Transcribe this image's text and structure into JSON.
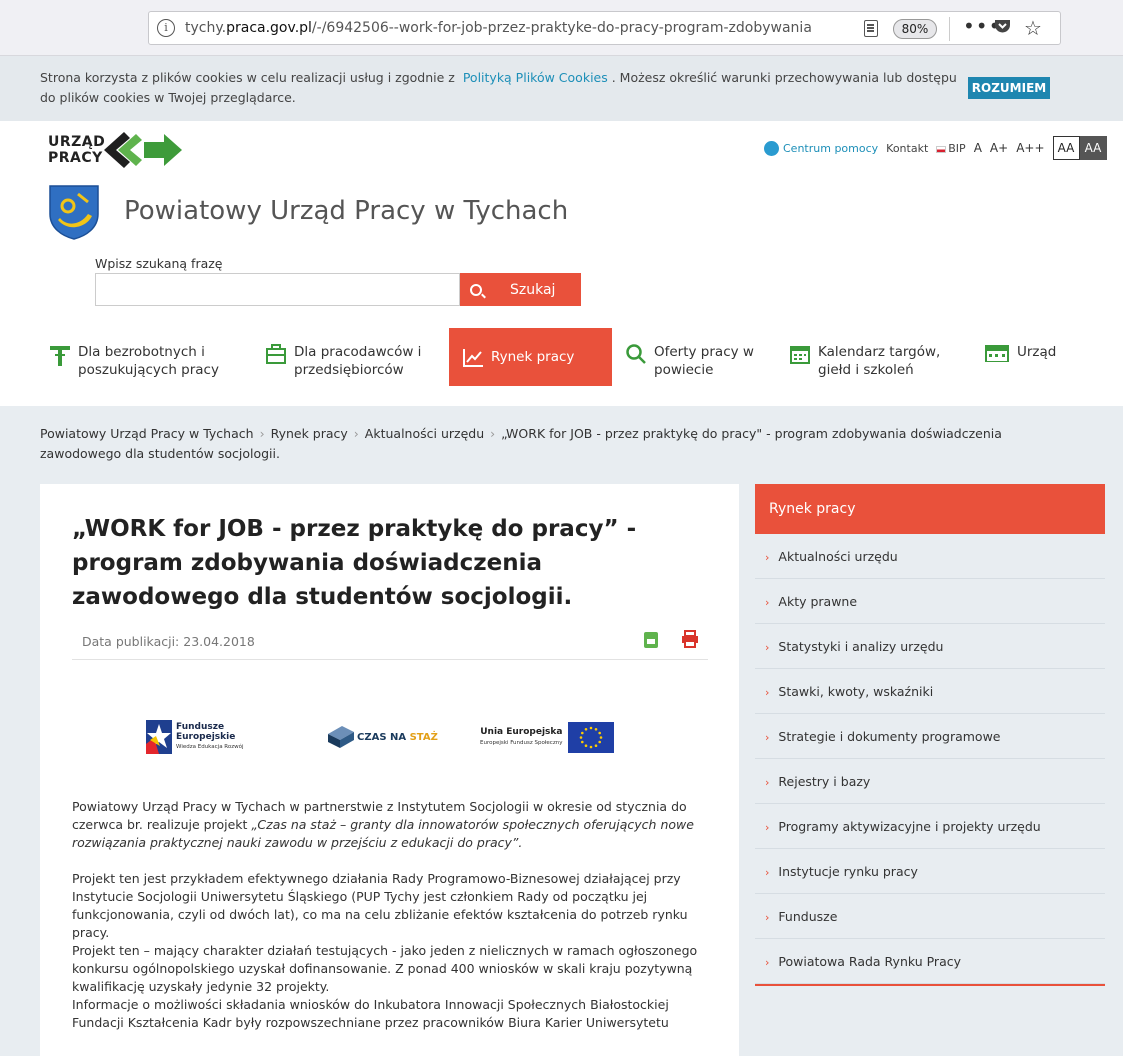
{
  "browser": {
    "url_prefix": "tychy.",
    "url_domain": "praca.gov.pl",
    "url_rest": "/-/6942506--work-for-job-przez-praktyke-do-pracy-program-zdobywania",
    "zoom": "80%",
    "menu_dots": "•••"
  },
  "cookie": {
    "text_before": "Strona korzysta z plików cookies w celu realizacji usług i zgodnie z",
    "link": "Polityką Plików Cookies",
    "text_after": ". Możesz określić warunki przechowywania lub dostępu do plików cookies w Twojej przeglądarce.",
    "button": "ROZUMIEM"
  },
  "header": {
    "logo_line1": "URZĄD",
    "logo_line2": "PRACY",
    "help": "Centrum pomocy",
    "contact": "Kontakt",
    "bip": "BIP",
    "font_sizes": [
      "A",
      "A+",
      "A++"
    ],
    "contrast": [
      "AA",
      "AA"
    ],
    "site_title": "Powiatowy Urząd Pracy w Tychach"
  },
  "search": {
    "label": "Wpisz szukaną frazę",
    "value": "",
    "button": "Szukaj"
  },
  "nav": [
    {
      "line1": "Dla bezrobotnych i",
      "line2": "poszukujących pracy"
    },
    {
      "line1": "Dla pracodawców i",
      "line2": "przedsiębiorców"
    },
    {
      "line1": "Rynek pracy",
      "line2": ""
    },
    {
      "line1": "Oferty pracy w",
      "line2": "powiecie"
    },
    {
      "line1": "Kalendarz targów,",
      "line2": "giełd i szkoleń"
    },
    {
      "line1": "Urząd",
      "line2": ""
    }
  ],
  "breadcrumb": {
    "items": [
      "Powiatowy Urząd Pracy w Tychach",
      "Rynek pracy",
      "Aktualności urzędu"
    ],
    "current": "„WORK for JOB - przez praktykę do pracy\" - program zdobywania doświadczenia zawodowego dla studentów socjologii.",
    "separator": "›"
  },
  "article": {
    "title": "„WORK for JOB - przez praktykę do pracy” - program zdobywania doświadczenia zawodowego dla studentów socjologii.",
    "pub_date": "Data publikacji: 23.04.2018",
    "logos": {
      "fe_name": "Fundusze",
      "fe_name2": "Europejskie",
      "fe_sub": "Wiedza Edukacja Rozwój",
      "czas1": "CZAS NA",
      "czas2": "STAŻ",
      "ue_name": "Unia Europejska",
      "ue_sub": "Europejski Fundusz Społeczny"
    },
    "p1_plain": "Powiatowy Urząd Pracy w Tychach w partnerstwie z Instytutem Socjologii w okresie od stycznia do czerwca br. realizuje projekt ",
    "p1_italic": "„Czas na staż – granty dla innowatorów społecznych oferujących nowe rozwiązania praktycznej nauki zawodu w przejściu z edukacji do pracy”.",
    "p2": "Projekt ten jest przykładem efektywnego działania Rady Programowo-Biznesowej działającej przy Instytucie Socjologii Uniwersytetu Śląskiego (PUP Tychy jest członkiem Rady od początku jej funkcjonowania, czyli od dwóch lat), co ma na celu zbliżanie efektów kształcenia do potrzeb rynku pracy.",
    "p3": "Projekt ten – mający charakter działań testujących - jako jeden z nielicznych w ramach ogłoszonego konkursu ogólnopolskiego uzyskał dofinansowanie. Z ponad 400 wniosków w skali kraju pozytywną kwalifikację uzyskały jedynie 32 projekty.",
    "p4": "Informacje o możliwości składania wniosków do Inkubatora Innowacji Społecznych Białostockiej Fundacji Kształcenia Kadr były rozpowszechniane przez pracowników Biura Karier Uniwersytetu"
  },
  "sidebar": {
    "title": "Rynek pracy",
    "items": [
      "Aktualności urzędu",
      "Akty prawne",
      "Statystyki i analizy urzędu",
      "Stawki, kwoty, wskaźniki",
      "Strategie i dokumenty programowe",
      "Rejestry i bazy",
      "Programy aktywizacyjne i projekty urzędu",
      "Instytucje rynku pracy",
      "Fundusze",
      "Powiatowa Rada Rynku Pracy"
    ]
  },
  "colors": {
    "accent": "#e9513b",
    "link": "#1d8fb8",
    "nav_icon_green": "#3a9a3a",
    "content_bg": "#e8edf1"
  },
  "icons": [
    "info-icon",
    "reader-view-icon",
    "pocket-icon",
    "bookmark-star-icon",
    "help-icon",
    "search-icon",
    "info-stand-icon",
    "briefcase-icon",
    "chart-line-icon",
    "magnifier-icon",
    "calendar-icon",
    "building-icon",
    "pdf-icon",
    "print-icon",
    "chevron-right-icon"
  ]
}
